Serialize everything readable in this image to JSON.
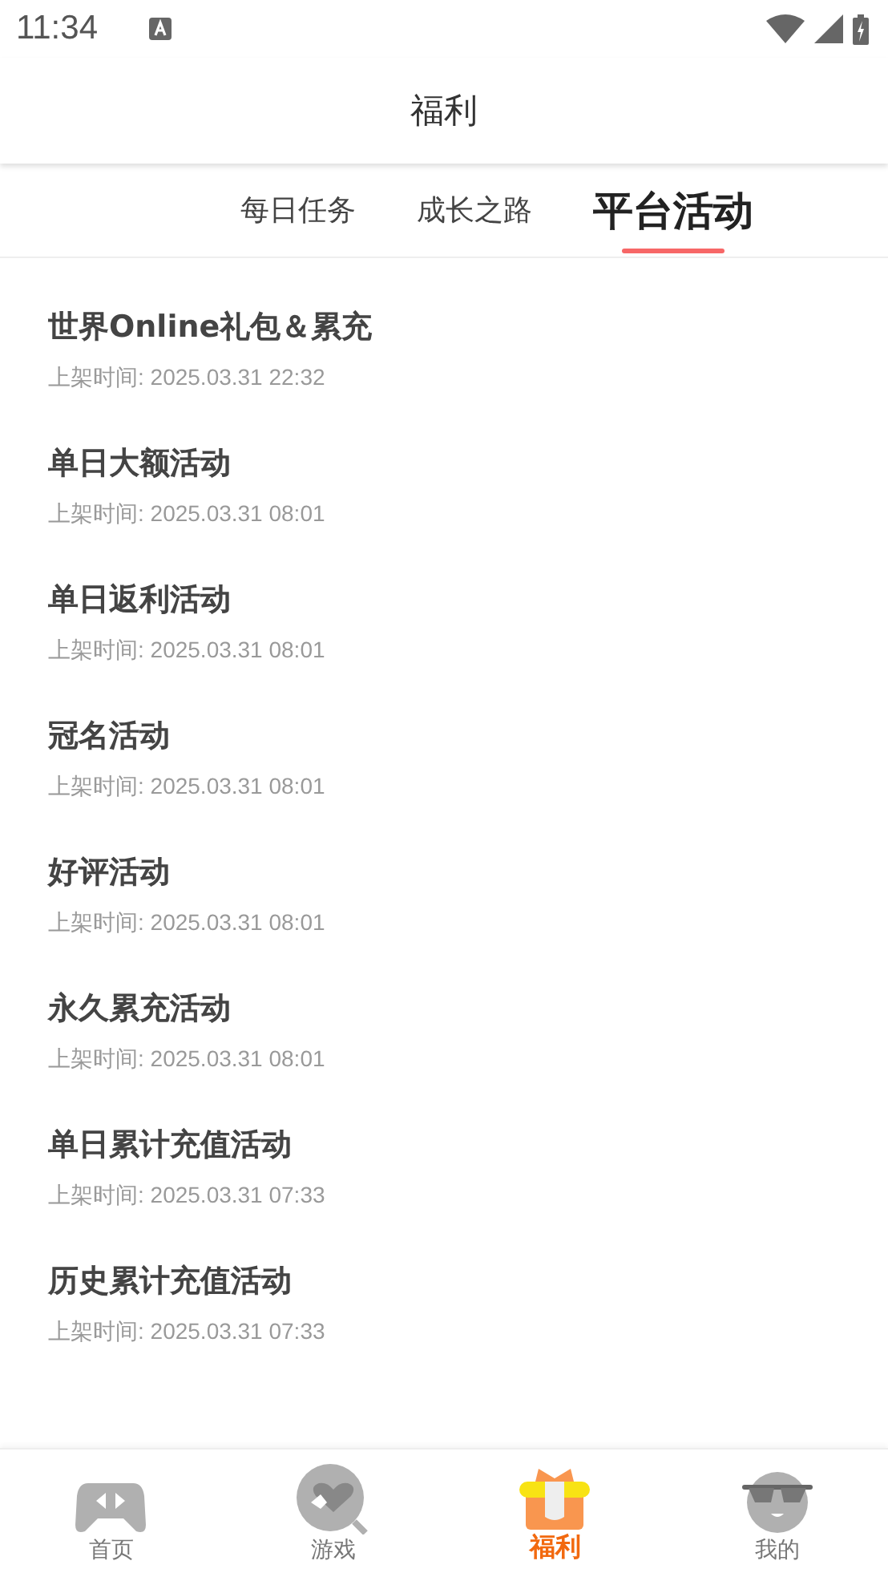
{
  "status_bar": {
    "time": "11:34"
  },
  "header": {
    "title": "福利"
  },
  "tabs": [
    {
      "label": "每日任务",
      "selected": false
    },
    {
      "label": "成长之路",
      "selected": false
    },
    {
      "label": "平台活动",
      "selected": true
    }
  ],
  "activities": [
    {
      "title": "世界Online礼包＆累充",
      "date": "上架时间: 2025.03.31 22:32"
    },
    {
      "title": "单日大额活动",
      "date": "上架时间: 2025.03.31 08:01"
    },
    {
      "title": "单日返利活动",
      "date": "上架时间: 2025.03.31 08:01"
    },
    {
      "title": "冠名活动",
      "date": "上架时间: 2025.03.31 08:01"
    },
    {
      "title": "好评活动",
      "date": "上架时间: 2025.03.31 08:01"
    },
    {
      "title": "永久累充活动",
      "date": "上架时间: 2025.03.31 08:01"
    },
    {
      "title": "单日累计充值活动",
      "date": "上架时间: 2025.03.31 07:33"
    },
    {
      "title": "历史累计充值活动",
      "date": "上架时间: 2025.03.31 07:33"
    }
  ],
  "bottom_nav": [
    {
      "kind": "home",
      "label": "首页",
      "selected": false
    },
    {
      "kind": "games",
      "label": "游戏",
      "selected": false
    },
    {
      "kind": "welfare",
      "label": "福利",
      "selected": true
    },
    {
      "kind": "mine",
      "label": "我的",
      "selected": false
    }
  ]
}
